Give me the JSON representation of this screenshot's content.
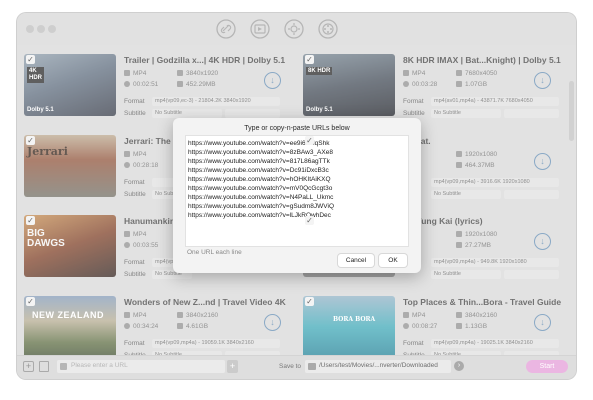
{
  "toolbar": {
    "icons": [
      "link-add-icon",
      "convert-icon",
      "settings-icon",
      "film-reel-icon"
    ]
  },
  "videos": [
    {
      "title": "Trailer | Godzilla x...| 4K HDR | Dolby 5.1",
      "format": "MP4",
      "resolution": "3840x1920",
      "duration": "00:02:51",
      "size": "452.29MB",
      "format_label": "Format",
      "format_value": "mp4(vp09,ec-3) - 21804.2K 3840x1920",
      "subtitle_label": "Subtitle",
      "subtitle_value": "No Subtitle",
      "thumb_badge_top": "4K\nHDR",
      "thumb_badge_bottom": "Dolby 5.1"
    },
    {
      "title": "8K HDR IMAX | Bat...Knight) | Dolby 5.1",
      "format": "MP4",
      "resolution": "7680x4050",
      "duration": "00:03:28",
      "size": "1.07GB",
      "format_label": "Format",
      "format_value": "mp4(av01,mp4a) - 43871.7K 7680x4050",
      "subtitle_label": "Subtitle",
      "subtitle_value": "No Subtitle",
      "thumb_badge_top": "8K HDR",
      "thumb_badge_bottom": "Dolby 5.1"
    },
    {
      "title": "Jerrari: The U",
      "format": "MP4",
      "resolution": "",
      "duration": "00:28:18",
      "size": "",
      "format_label": "Format",
      "format_value": "",
      "subtitle_label": "Subtitle",
      "subtitle_value": "No Subtitle",
      "thumb_badge_top": "Jerrari",
      "thumb_badge_bottom": ""
    },
    {
      "title": "cat.",
      "format": "",
      "resolution": "1920x1080",
      "duration": "",
      "size": "464.37MB",
      "format_label": "Format",
      "format_value": "mp4(vp09,mp4a) - 3916.6K 1920x1080",
      "subtitle_label": "Subtitle",
      "subtitle_value": "No Subtitle",
      "thumb_badge_top": "",
      "thumb_badge_bottom": ""
    },
    {
      "title": "Hanumankind",
      "format": "MP4",
      "resolution": "",
      "duration": "00:03:55",
      "size": "",
      "format_label": "Format",
      "format_value": "mp4(vp09,mp4a) - ",
      "subtitle_label": "Subtitle",
      "subtitle_value": "No Subtitle",
      "thumb_badge_top": "BIG\nDAWGS",
      "thumb_badge_bottom": ""
    },
    {
      "title": "Yung Kai (lyrics)",
      "format": "",
      "resolution": "1920x1080",
      "duration": "",
      "size": "27.27MB",
      "format_label": "Format",
      "format_value": "mp4(vp09,mp4a) - 949.8K 1920x1080",
      "subtitle_label": "Subtitle",
      "subtitle_value": "No Subtitle",
      "thumb_badge_top": "",
      "thumb_badge_bottom": ""
    },
    {
      "title": "Wonders of New Z...nd | Travel Video 4K",
      "format": "MP4",
      "resolution": "3840x2160",
      "duration": "00:34:24",
      "size": "4.61GB",
      "format_label": "Format",
      "format_value": "mp4(vp09,mp4a) - 19059.1K 3840x2160",
      "subtitle_label": "Subtitle",
      "subtitle_value": "No Subtitle",
      "thumb_badge_top": "NEW ZEALAND",
      "thumb_badge_bottom": ""
    },
    {
      "title": "Top Places & Thin...Bora - Travel Guide",
      "format": "MP4",
      "resolution": "3840x2160",
      "duration": "00:08:27",
      "size": "1.13GB",
      "format_label": "Format",
      "format_value": "mp4(vp09,mp4a) - 19025.1K 3840x2160",
      "subtitle_label": "Subtitle",
      "subtitle_value": "No Subtitle",
      "thumb_badge_top": "BORA BORA",
      "thumb_badge_bottom": ""
    }
  ],
  "footer": {
    "url_placeholder": "Please enter a URL",
    "save_to_label": "Save to",
    "save_path": "/Users/test/Movies/...nverter/Downloaded",
    "start_label": "Start"
  },
  "dialog": {
    "title": "Type or copy-n-paste URLs below",
    "urls": "https://www.youtube.com/watch?v=ee9i6oMqShk\nhttps://www.youtube.com/watch?v=8zBAw3_AXe8\nhttps://www.youtube.com/watch?v=817L86agTTk\nhttps://www.youtube.com/watch?v=Dc91iDxcB3c\nhttps://www.youtube.com/watch?v=hOHKItAiKXQ\nhttps://www.youtube.com/watch?v=mV0QcGcgt3o\nhttps://www.youtube.com/watch?v=N4PaLL_Ukmc\nhttps://www.youtube.com/watch?v=gSudm8JWViQ\nhttps://www.youtube.com/watch?v=lLJkRQwhDec",
    "hint": "One URL each line",
    "cancel_label": "Cancel",
    "ok_label": "OK"
  },
  "colors": {
    "accent_start": "#e04ed0",
    "download_icon": "#5d88b0"
  }
}
